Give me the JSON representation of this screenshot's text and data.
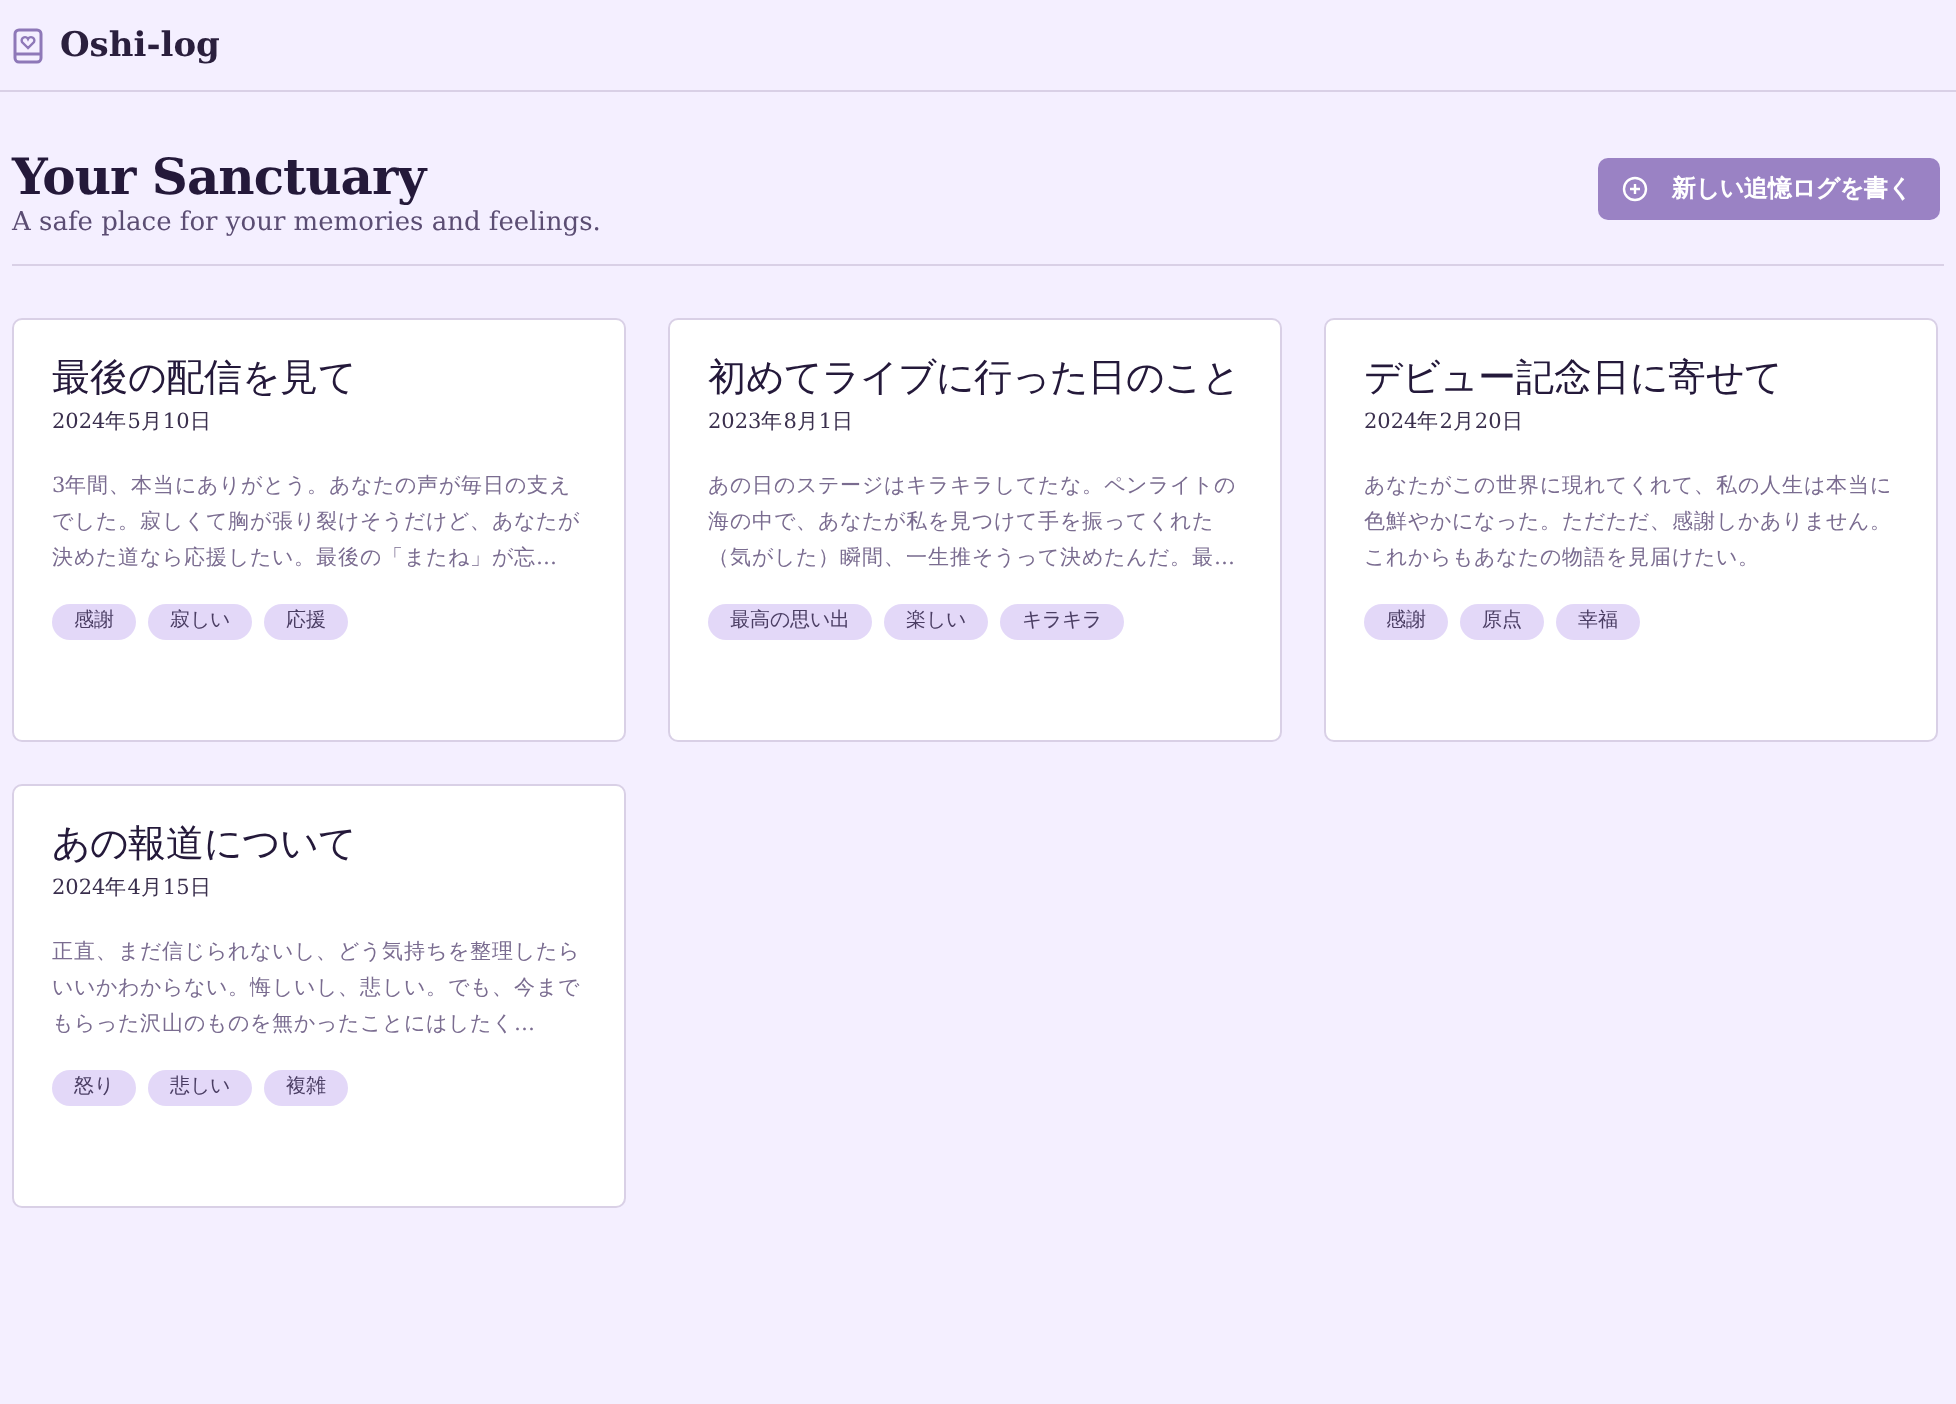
{
  "app": {
    "name": "Oshi-log"
  },
  "hero": {
    "title": "Your Sanctuary",
    "subtitle": "A safe place for your memories and feelings.",
    "button": "新しい追憶ログを書く"
  },
  "cards": [
    {
      "title": "最後の配信を見て",
      "date": "2024年5月10日",
      "excerpt": "3年間、本当にありがとう。あなたの声が毎日の支えでした。寂しくて胸が張り裂けそうだけど、あなたが決めた道なら応援したい。最後の「またね」が忘…",
      "tags": [
        "感謝",
        "寂しい",
        "応援"
      ]
    },
    {
      "title": "初めてライブに行った日のこと",
      "date": "2023年8月1日",
      "excerpt": "あの日のステージはキラキラしてたな。ペンライトの海の中で、あなたが私を見つけて手を振ってくれた（気がした）瞬間、一生推そうって決めたんだ。最…",
      "tags": [
        "最高の思い出",
        "楽しい",
        "キラキラ"
      ]
    },
    {
      "title": "デビュー記念日に寄せて",
      "date": "2024年2月20日",
      "excerpt": "あなたがこの世界に現れてくれて、私の人生は本当に色鮮やかになった。ただただ、感謝しかありません。これからもあなたの物語を見届けたい。",
      "tags": [
        "感謝",
        "原点",
        "幸福"
      ]
    },
    {
      "title": "あの報道について",
      "date": "2024年4月15日",
      "excerpt": "正直、まだ信じられないし、どう気持ちを整理したらいいかわからない。悔しいし、悲しい。でも、今までもらった沢山のものを無かったことにはしたく…",
      "tags": [
        "怒り",
        "悲しい",
        "複雑"
      ]
    }
  ]
}
